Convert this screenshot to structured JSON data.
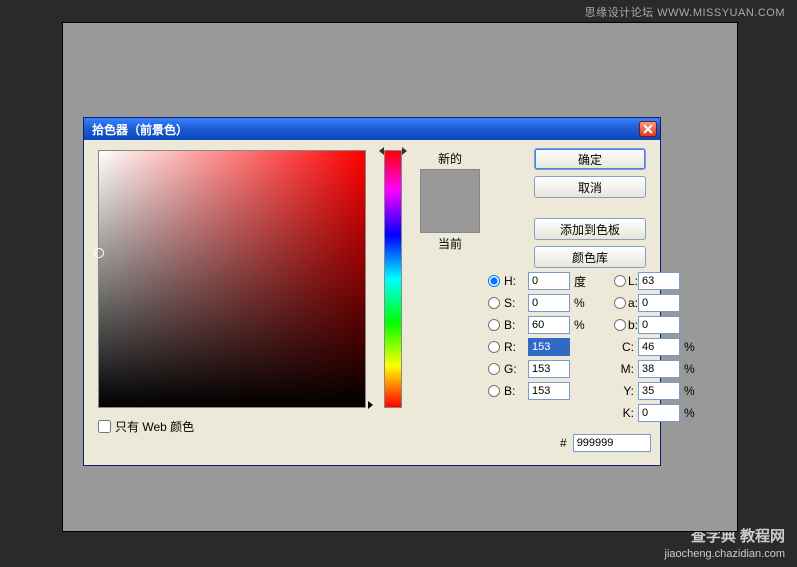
{
  "watermark_top": "思缘设计论坛  WWW.MISSYUAN.COM",
  "watermark_bottom_big": "查字典 教程网",
  "watermark_bottom_small": "jiaocheng.chazidian.com",
  "dialog": {
    "title": "拾色器（前景色）",
    "new_label": "新的",
    "current_label": "当前",
    "web_only_label": "只有 Web 颜色",
    "hex_prefix": "#",
    "hex_value": "999999",
    "swatch_new": "#999999",
    "swatch_current": "#999999",
    "picker": {
      "left_pct": 0,
      "top_pct": 40
    },
    "buttons": {
      "ok": "确定",
      "cancel": "取消",
      "add_swatch": "添加到色板",
      "libraries": "颜色库"
    },
    "hsb": {
      "h": {
        "label": "H:",
        "value": "0",
        "unit": "度"
      },
      "s": {
        "label": "S:",
        "value": "0",
        "unit": "%"
      },
      "b": {
        "label": "B:",
        "value": "60",
        "unit": "%"
      }
    },
    "rgb": {
      "r": {
        "label": "R:",
        "value": "153"
      },
      "g": {
        "label": "G:",
        "value": "153"
      },
      "b": {
        "label": "B:",
        "value": "153"
      }
    },
    "lab": {
      "l": {
        "label": "L:",
        "value": "63"
      },
      "a": {
        "label": "a:",
        "value": "0"
      },
      "b": {
        "label": "b:",
        "value": "0"
      }
    },
    "cmyk": {
      "c": {
        "label": "C:",
        "value": "46",
        "unit": "%"
      },
      "m": {
        "label": "M:",
        "value": "38",
        "unit": "%"
      },
      "y": {
        "label": "Y:",
        "value": "35",
        "unit": "%"
      },
      "k": {
        "label": "K:",
        "value": "0",
        "unit": "%"
      }
    }
  }
}
